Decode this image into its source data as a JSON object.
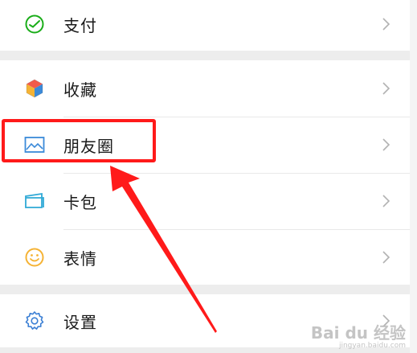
{
  "menu": {
    "pay": "支付",
    "favorites": "收藏",
    "moments": "朋友圈",
    "cards": "卡包",
    "stickers": "表情",
    "settings": "设置"
  },
  "watermark": {
    "logo": "Bai du 经验",
    "url": "jingyan.baidu.com"
  },
  "colors": {
    "pay_green": "#1aad19",
    "highlight_red": "#ff1a1a",
    "moments_blue": "#3b8ad9",
    "sticker_orange": "#f5b335",
    "settings_blue": "#3b7fd4"
  }
}
